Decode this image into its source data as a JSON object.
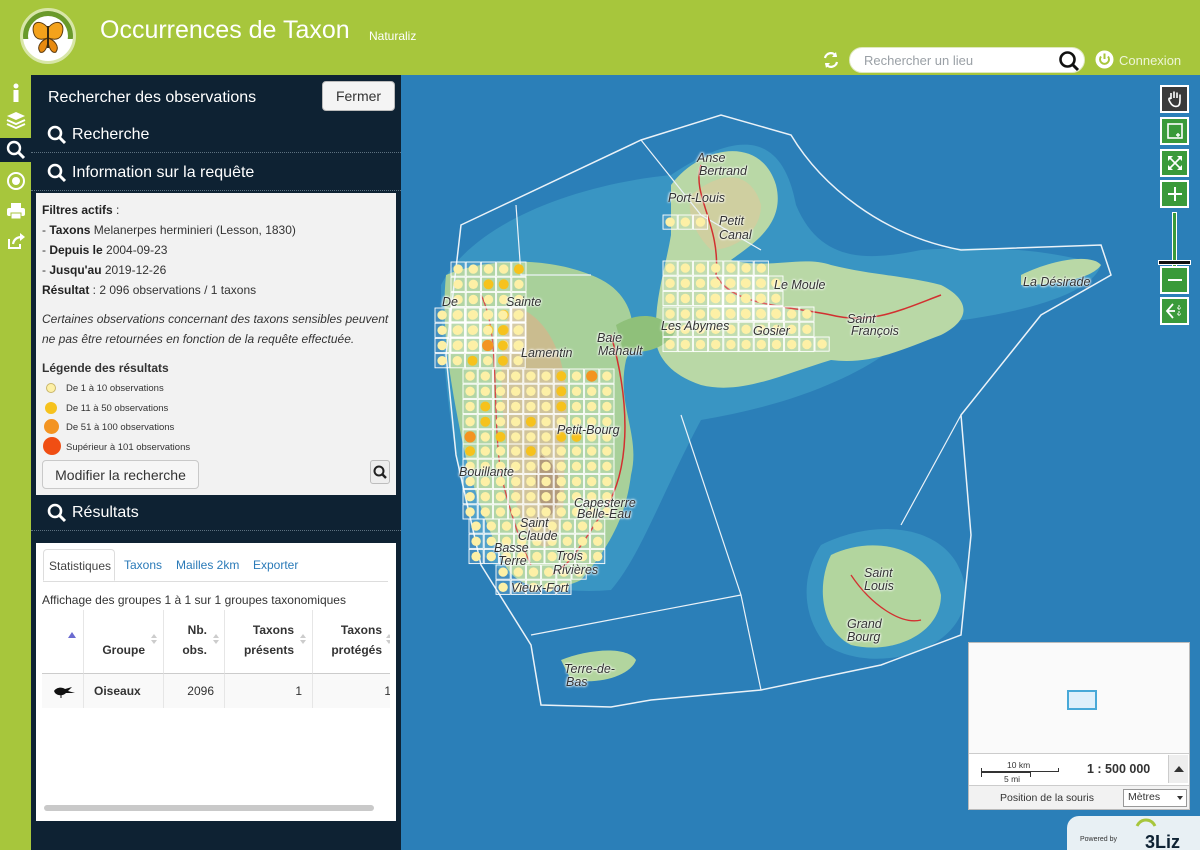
{
  "header": {
    "title": "Occurrences de Taxon",
    "subtitle": "Naturaliz",
    "search_placeholder": "Rechercher un lieu",
    "login_label": "Connexion"
  },
  "panel": {
    "title": "Rechercher des observations",
    "close_label": "Fermer",
    "section_search": "Recherche",
    "section_info": "Information sur la requête",
    "section_results": "Résultats"
  },
  "filters": {
    "active_label": "Filtres actifs",
    "active_suffix": " :",
    "dash": "- ",
    "taxon_label": "Taxons",
    "taxon_value": " Melanerpes herminieri (Lesson, 1830)",
    "from_label": "Depuis le",
    "from_value": " 2004-09-23",
    "to_label": "Jusqu'au",
    "to_value": " 2019-12-26",
    "result_label": "Résultat",
    "result_value": " : 2 096 observations / 1 taxons",
    "note": "Certaines observations concernant des taxons sensibles peuvent ne pas être retournées en fonction de la requête effectuée.",
    "modify_label": "Modifier la recherche"
  },
  "legend": {
    "title": "Légende des résultats",
    "items": [
      {
        "label": "De 1 à 10 observations",
        "color": "#fdf0a6"
      },
      {
        "label": "De 11 à 50 observations",
        "color": "#f6c21d"
      },
      {
        "label": "De 51 à 100 observations",
        "color": "#f39422"
      },
      {
        "label": "Supérieur à 101 observations",
        "color": "#f04e13"
      }
    ]
  },
  "results": {
    "tabs": [
      "Statistiques",
      "Taxons",
      "Mailles 2km",
      "Exporter"
    ],
    "table_info": "Affichage des groupes 1 à 1 sur 1 groupes taxonomiques",
    "columns": [
      "Groupe",
      "Nb.",
      "obs.",
      "Taxons",
      "présents",
      "Taxons",
      "protégés"
    ],
    "row": {
      "icon": "bird-icon",
      "group": "Oiseaux",
      "nb_obs": "2096",
      "present": "1",
      "protected": "1"
    }
  },
  "map": {
    "places": [
      "Anse",
      "Bertrand",
      "Port-Louis",
      "Petit",
      "Canal",
      "Le Moule",
      "La Désirade",
      "Sainte",
      "De",
      "Baie",
      "Mahault",
      "Les Abymes",
      "Saint",
      "François",
      "Gosier",
      "Lamentin",
      "Capesterre",
      "Belle-Eau",
      "Saint",
      "Claude",
      "Basse",
      "Terre",
      "Trois",
      "Rivières",
      "Vieux-Fort",
      "Saint",
      "Louis",
      "Grand",
      "Bourg",
      "Terre-de-",
      "Bas",
      "Petit-Bourg",
      "Bouillante"
    ],
    "scale_km": "10 km",
    "scale_mi": "5 mi",
    "scale_ratio": "1 : 500 000",
    "mouse_position_label": "Position de la souris",
    "unit": "Mètres",
    "powered_by": "Powered by",
    "brand": "3Liz"
  },
  "colors": {
    "header": "#a7c63c",
    "panel": "#0e2233",
    "sea": "#2b7fb8",
    "accent": "#3a9a3a"
  }
}
